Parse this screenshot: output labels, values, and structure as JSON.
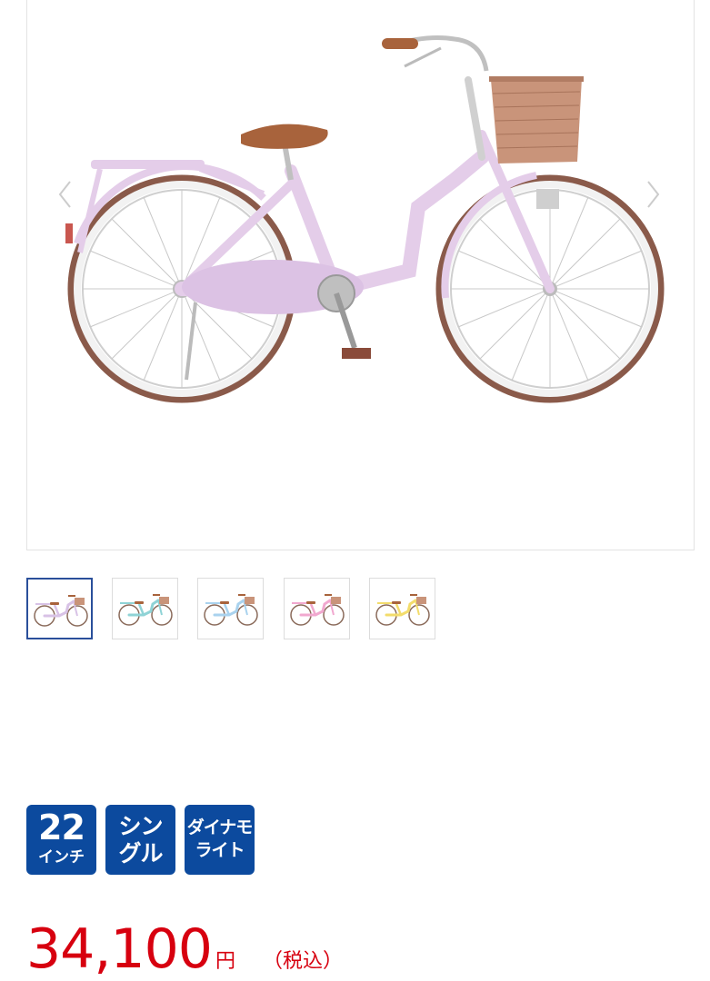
{
  "gallery": {
    "main_image_name": "pink bicycle with basket",
    "prev_icon": "chevron-left-icon",
    "next_icon": "chevron-right-icon",
    "colors": {
      "frame": "#e4cde9",
      "saddle": "#a8633c",
      "basket": "#c9947a",
      "tire": "#8a5a4a"
    }
  },
  "thumbnails": [
    {
      "color": "#d8c2e6",
      "label": "lavender"
    },
    {
      "color": "#8fd3d6",
      "label": "mint"
    },
    {
      "color": "#a9d2ee",
      "label": "light-blue"
    },
    {
      "color": "#f1a8cf",
      "label": "pink"
    },
    {
      "color": "#f3dc6b",
      "label": "yellow"
    }
  ],
  "badges": [
    {
      "line1": "22",
      "line2": "インチ"
    },
    {
      "line1": "シン",
      "line2": "グル"
    },
    {
      "line1": "ダイナモ",
      "line2": "ライト"
    }
  ],
  "price": {
    "amount": "34,100",
    "currency": "円",
    "tax_note": "（税込）"
  },
  "accent_color": "#d7000f",
  "badge_color": "#0c4a9e",
  "thumb_active_color": "#2a4f9a"
}
